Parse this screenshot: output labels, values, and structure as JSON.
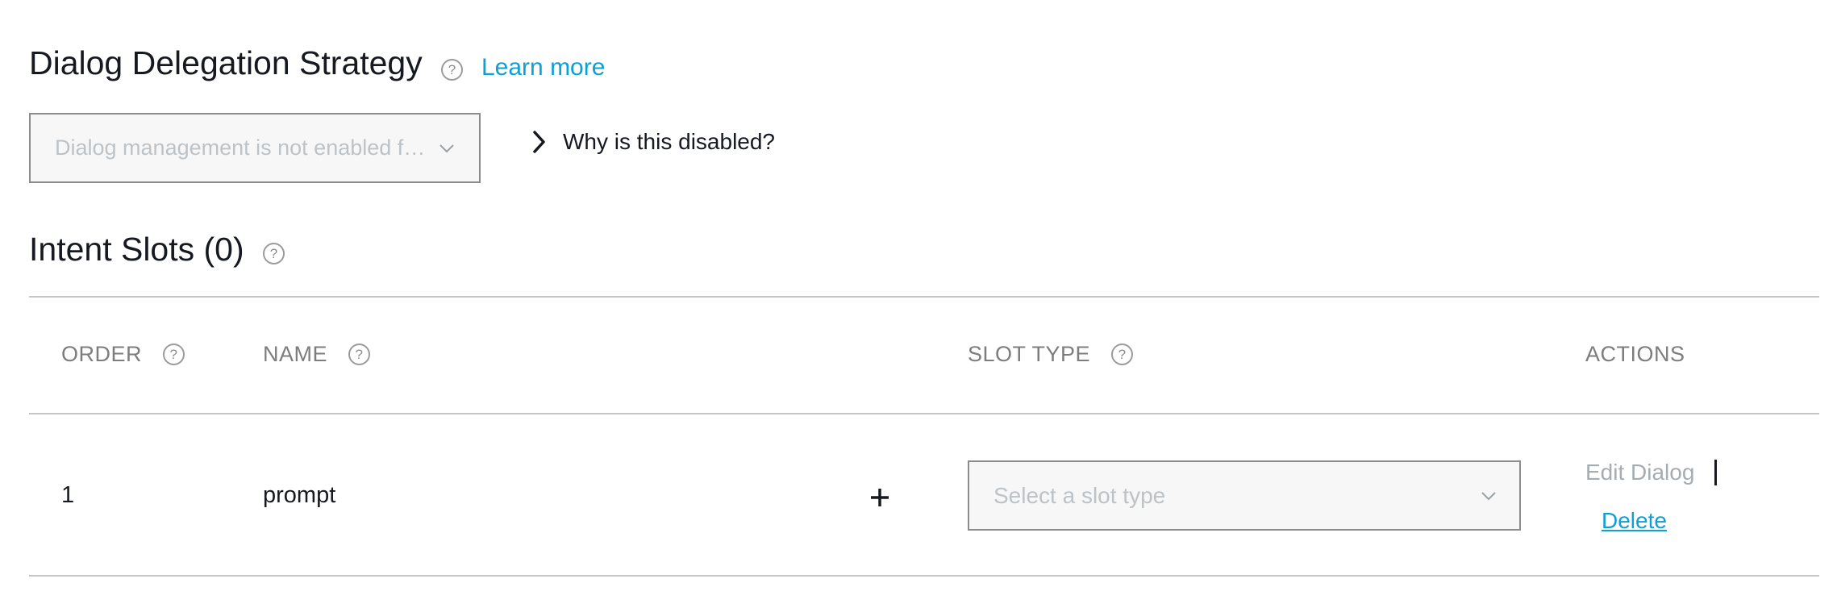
{
  "dialog_delegation": {
    "title": "Dialog Delegation Strategy",
    "learn_more": "Learn more",
    "select_value": "Dialog management is not enabled for this skill",
    "why_disabled": "Why is this disabled?"
  },
  "intent_slots": {
    "title": "Intent Slots (0)",
    "columns": {
      "order": "ORDER",
      "name": "NAME",
      "slot_type": "SLOT TYPE",
      "actions": "ACTIONS"
    },
    "rows": [
      {
        "order": "1",
        "name": "prompt",
        "slot_type_placeholder": "Select a slot type",
        "edit_dialog": "Edit Dialog",
        "delete": "Delete"
      }
    ]
  },
  "help_icon_glyph": "?",
  "colors": {
    "link": "#0d9fd8",
    "disabled_text": "#bcc3c8",
    "muted_header": "#7d7d7d",
    "divider": "#c6c6c6"
  },
  "icons": {
    "help": "help-circle-icon",
    "chevron_down": "chevron-down-icon",
    "chevron_right": "chevron-right-icon",
    "plus": "plus-icon"
  }
}
